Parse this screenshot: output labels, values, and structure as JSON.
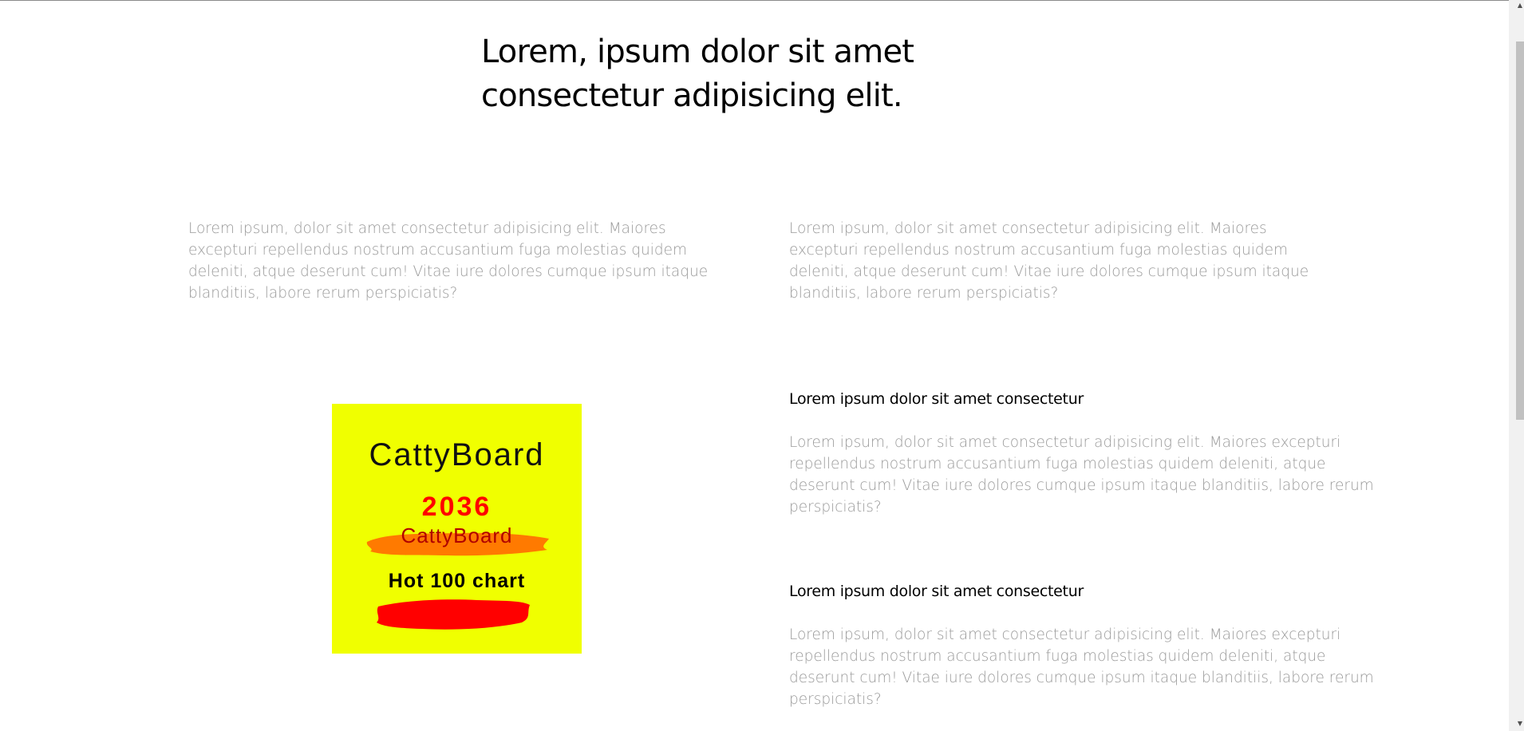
{
  "hero": {
    "title": "Lorem, ipsum dolor sit amet consectetur adipisicing elit."
  },
  "intro": {
    "left_text": "Lorem ipsum, dolor sit amet consectetur adipisicing elit. Maiores excepturi repellendus nostrum accusantium fuga molestias quidem deleniti, atque deserunt cum! Vitae iure dolores cumque ipsum itaque blanditiis, labore rerum perspiciatis?",
    "right_text": "Lorem ipsum, dolor sit amet consectetur adipisicing elit. Maiores excepturi repellendus nostrum accusantium fuga molestias quidem deleniti, atque deserunt cum! Vitae iure dolores cumque ipsum itaque blanditiis, labore rerum perspiciatis?"
  },
  "logo": {
    "title": "CattyBoard",
    "year": "2036",
    "subtitle": "CattyBoard",
    "tagline": "Hot 100 chart",
    "background_color": "#f0ff00",
    "accent_red": "#ff0000",
    "accent_orange": "#ff7a00"
  },
  "features": [
    {
      "heading": "Lorem ipsum dolor sit amet consectetur",
      "text": "Lorem ipsum, dolor sit amet consectetur adipisicing elit. Maiores excepturi repellendus nostrum accusantium fuga molestias quidem deleniti, atque deserunt cum! Vitae iure dolores cumque ipsum itaque blanditiis, labore rerum perspiciatis?"
    },
    {
      "heading": "Lorem ipsum dolor sit amet consectetur",
      "text": "Lorem ipsum, dolor sit amet consectetur adipisicing elit. Maiores excepturi repellendus nostrum accusantium fuga molestias quidem deleniti, atque deserunt cum! Vitae iure dolores cumque ipsum itaque blanditiis, labore rerum perspiciatis?"
    }
  ],
  "scrollbar": {
    "up_icon": "scroll-up-arrow-icon",
    "down_icon": "scroll-down-arrow-icon"
  }
}
